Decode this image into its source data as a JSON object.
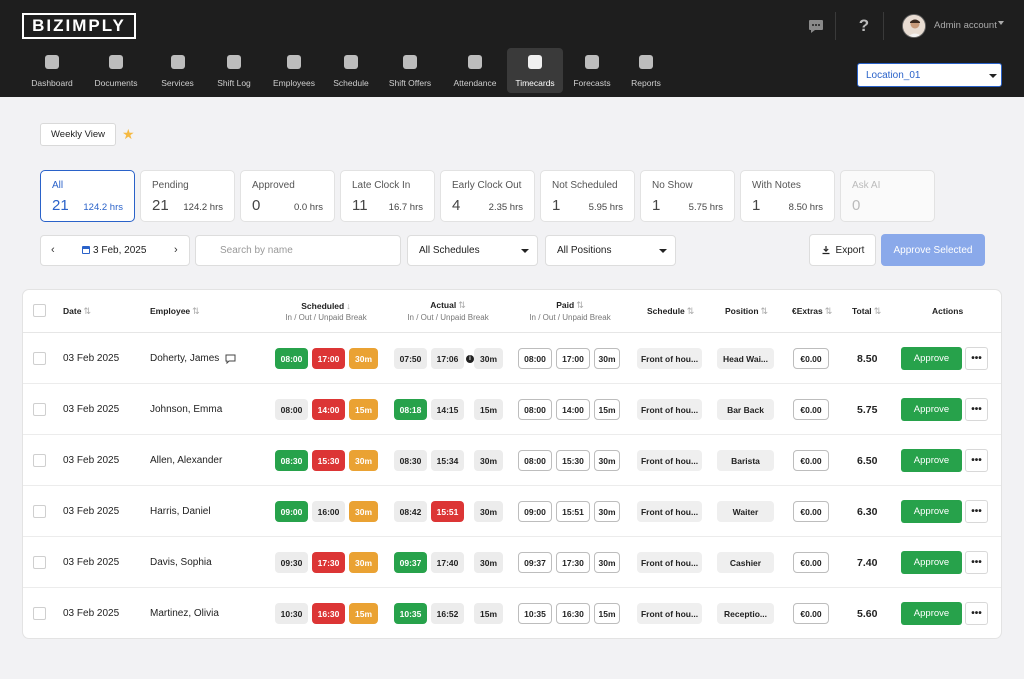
{
  "app": {
    "logo": "BIZIMPLY",
    "user": "Admin account"
  },
  "nav": [
    {
      "label": "Dashboard",
      "icon": "dashboard-icon"
    },
    {
      "label": "Documents",
      "icon": "documents-icon"
    },
    {
      "label": "Services",
      "icon": "services-icon"
    },
    {
      "label": "Shift Log",
      "icon": "shift-log-icon"
    },
    {
      "label": "Employees",
      "icon": "employees-icon"
    },
    {
      "label": "Schedule",
      "icon": "schedule-icon"
    },
    {
      "label": "Shift Offers",
      "icon": "shift-offers-icon"
    },
    {
      "label": "Attendance",
      "icon": "attendance-icon"
    },
    {
      "label": "Timecards",
      "icon": "timecards-icon",
      "active": true
    },
    {
      "label": "Forecasts",
      "icon": "forecasts-icon"
    },
    {
      "label": "Reports",
      "icon": "reports-icon"
    }
  ],
  "location": "Location_01",
  "view": {
    "weekly_label": "Weekly View"
  },
  "cards": [
    {
      "label": "All",
      "count": "21",
      "hours": "124.2 hrs"
    },
    {
      "label": "Pending",
      "count": "21",
      "hours": "124.2 hrs"
    },
    {
      "label": "Approved",
      "count": "0",
      "hours": "0.0 hrs"
    },
    {
      "label": "Late Clock In",
      "count": "11",
      "hours": "16.7 hrs"
    },
    {
      "label": "Early Clock Out",
      "count": "4",
      "hours": "2.35 hrs"
    },
    {
      "label": "Not Scheduled",
      "count": "1",
      "hours": "5.95 hrs"
    },
    {
      "label": "No Show",
      "count": "1",
      "hours": "5.75 hrs"
    },
    {
      "label": "With Notes",
      "count": "1",
      "hours": "8.50 hrs"
    },
    {
      "label": "Ask AI",
      "count": "0",
      "hours": ""
    }
  ],
  "filters": {
    "date": "3 Feb, 2025",
    "search_placeholder": "Search by name",
    "schedules": "All Schedules",
    "positions": "All Positions",
    "export": "Export",
    "approve_selected": "Approve Selected"
  },
  "table": {
    "headers": {
      "date": "Date",
      "employee": "Employee",
      "scheduled": "Scheduled",
      "scheduled_sub": "In / Out / Unpaid Break",
      "actual": "Actual",
      "actual_sub": "In / Out / Unpaid Break",
      "paid": "Paid",
      "paid_sub": "In / Out / Unpaid Break",
      "schedule": "Schedule",
      "position": "Position",
      "extras": "€Extras",
      "total": "Total",
      "actions": "Actions"
    },
    "approve_label": "Approve",
    "more_label": "•••",
    "rows": [
      {
        "date": "03 Feb 2025",
        "employee": "Doherty, James",
        "note": true,
        "sched": [
          "08:00",
          "17:00",
          "30m"
        ],
        "sched_style": [
          "green",
          "red",
          "orange"
        ],
        "actual": [
          "07:50",
          "17:06",
          "30m"
        ],
        "actual_style": [
          "grey",
          "grey",
          "grey"
        ],
        "actual_info": true,
        "paid": [
          "08:00",
          "17:00",
          "30m"
        ],
        "schedule": "Front of hou...",
        "position": "Head Wai...",
        "extras": "€0.00",
        "total": "8.50"
      },
      {
        "date": "03 Feb 2025",
        "employee": "Johnson, Emma",
        "note": false,
        "sched": [
          "08:00",
          "14:00",
          "15m"
        ],
        "sched_style": [
          "grey",
          "red",
          "orange"
        ],
        "actual": [
          "08:18",
          "14:15",
          "15m"
        ],
        "actual_style": [
          "green",
          "grey",
          "grey"
        ],
        "actual_info": false,
        "paid": [
          "08:00",
          "14:00",
          "15m"
        ],
        "schedule": "Front of hou...",
        "position": "Bar Back",
        "extras": "€0.00",
        "total": "5.75"
      },
      {
        "date": "03 Feb 2025",
        "employee": "Allen, Alexander",
        "note": false,
        "sched": [
          "08:30",
          "15:30",
          "30m"
        ],
        "sched_style": [
          "green",
          "red",
          "orange"
        ],
        "actual": [
          "08:30",
          "15:34",
          "30m"
        ],
        "actual_style": [
          "grey",
          "grey",
          "grey"
        ],
        "actual_info": false,
        "paid": [
          "08:00",
          "15:30",
          "30m"
        ],
        "schedule": "Front of hou...",
        "position": "Barista",
        "extras": "€0.00",
        "total": "6.50"
      },
      {
        "date": "03 Feb 2025",
        "employee": "Harris, Daniel",
        "note": false,
        "sched": [
          "09:00",
          "16:00",
          "30m"
        ],
        "sched_style": [
          "green",
          "grey",
          "orange"
        ],
        "actual": [
          "08:42",
          "15:51",
          "30m"
        ],
        "actual_style": [
          "grey",
          "red",
          "grey"
        ],
        "actual_info": false,
        "paid": [
          "09:00",
          "15:51",
          "30m"
        ],
        "schedule": "Front of hou...",
        "position": "Waiter",
        "extras": "€0.00",
        "total": "6.30"
      },
      {
        "date": "03 Feb 2025",
        "employee": "Davis, Sophia",
        "note": false,
        "sched": [
          "09:30",
          "17:30",
          "30m"
        ],
        "sched_style": [
          "grey",
          "red",
          "orange"
        ],
        "actual": [
          "09:37",
          "17:40",
          "30m"
        ],
        "actual_style": [
          "green",
          "grey",
          "grey"
        ],
        "actual_info": false,
        "paid": [
          "09:37",
          "17:30",
          "30m"
        ],
        "schedule": "Front of hou...",
        "position": "Cashier",
        "extras": "€0.00",
        "total": "7.40"
      },
      {
        "date": "03 Feb 2025",
        "employee": "Martinez, Olivia",
        "note": false,
        "sched": [
          "10:30",
          "16:30",
          "15m"
        ],
        "sched_style": [
          "grey",
          "red",
          "orange"
        ],
        "actual": [
          "10:35",
          "16:52",
          "15m"
        ],
        "actual_style": [
          "green",
          "grey",
          "grey"
        ],
        "actual_info": false,
        "paid": [
          "10:35",
          "16:30",
          "15m"
        ],
        "schedule": "Front of hou...",
        "position": "Receptio...",
        "extras": "€0.00",
        "total": "5.60"
      }
    ]
  },
  "colors": {
    "accent": "#2a62c9",
    "green": "#27a24b",
    "red": "#dc3535",
    "orange": "#eaa233"
  }
}
